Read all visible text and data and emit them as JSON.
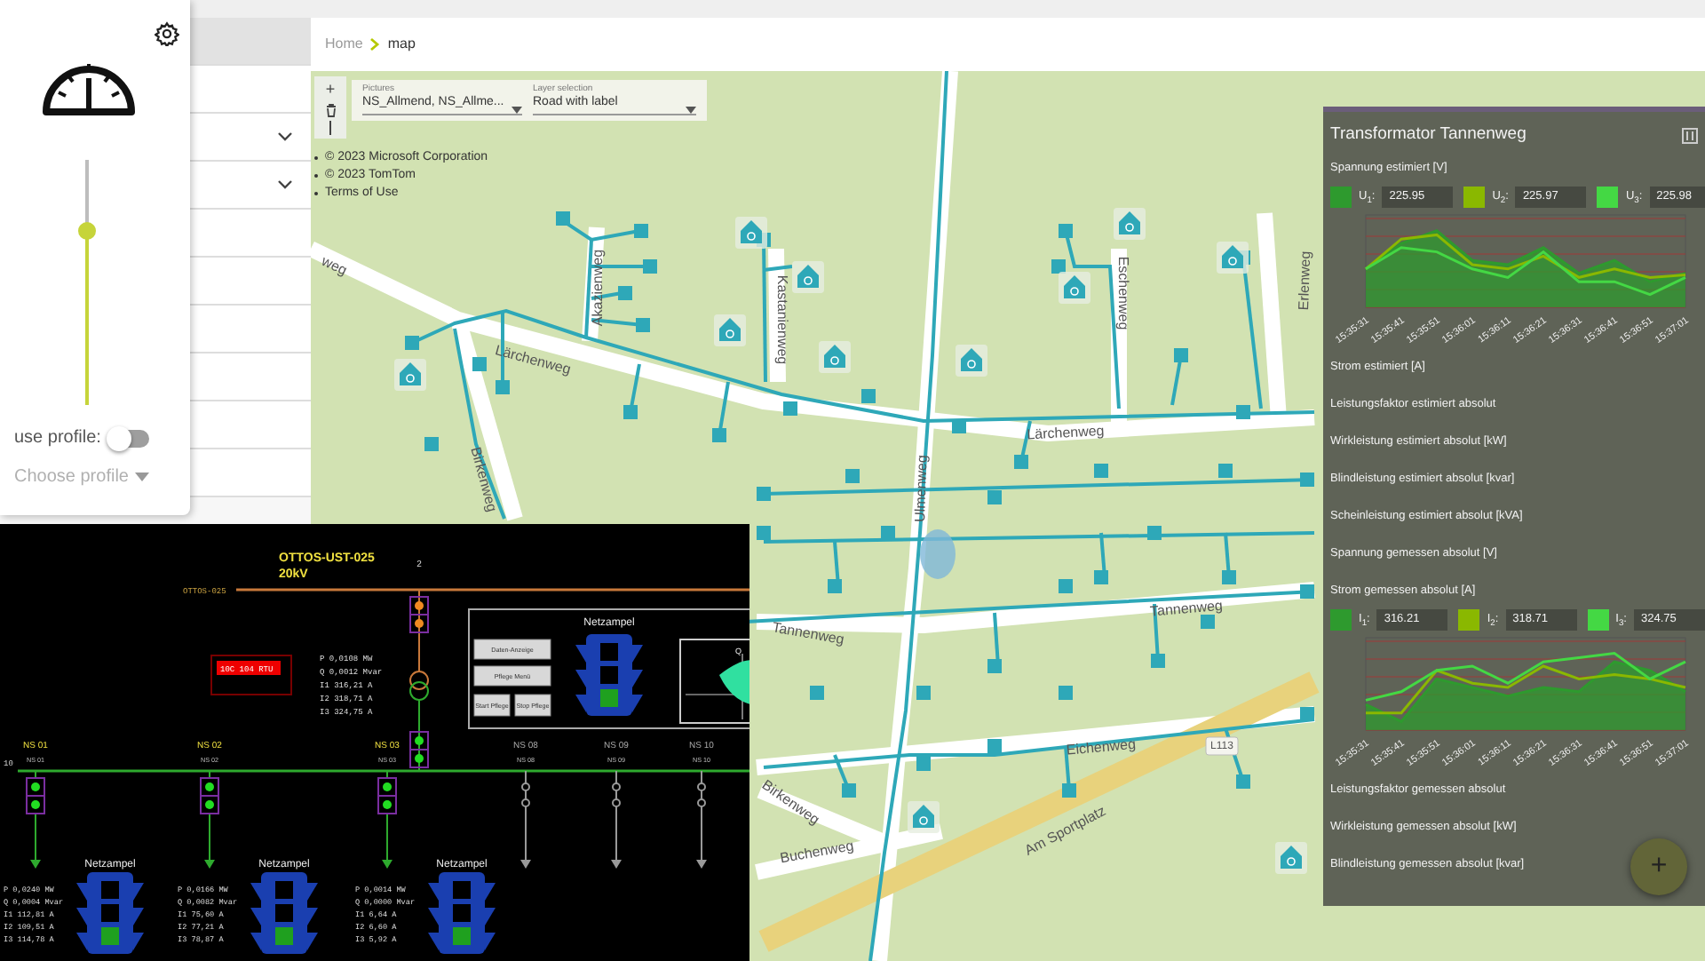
{
  "header": {
    "breadcrumb": [
      {
        "label": "Home",
        "selected": false
      },
      {
        "label": "map",
        "selected": true
      }
    ]
  },
  "settings_card": {
    "slider": {
      "level": 0.71
    },
    "use_profile": {
      "label": "use profile:",
      "on": false
    },
    "profile_select": {
      "placeholder": "Choose profile"
    }
  },
  "sidebar": {
    "rows": [
      {
        "kind": "header"
      },
      {
        "kind": "plain"
      },
      {
        "kind": "expandable"
      },
      {
        "kind": "expandable"
      },
      {
        "kind": "plain"
      },
      {
        "kind": "plain"
      },
      {
        "kind": "plain"
      },
      {
        "kind": "plain"
      },
      {
        "kind": "plain"
      },
      {
        "kind": "plain"
      }
    ]
  },
  "map": {
    "toolbar": {
      "zoom_in": "+"
    },
    "pictures_select": {
      "label": "Pictures",
      "value": "NS_Allmend, NS_Allme..."
    },
    "layer_select": {
      "label": "Layer selection",
      "value": "Road with label"
    },
    "attribution": [
      "© 2023 Microsoft Corporation",
      "© 2023 TomTom",
      "Terms of Use"
    ],
    "street_labels": [
      "weg",
      "Lärchenweg",
      "Lärchenweg",
      "Ulmenweg",
      "Tannenweg",
      "Tannenweg",
      "Eichenweg",
      "Birkenweg",
      "Buchenweg",
      "Am Sportplatz",
      "Akazienweg",
      "Kastanienweg",
      "Eschenweg",
      "Erlenweg",
      "Birkenweg",
      "L113"
    ]
  },
  "scada": {
    "station": "OTTOS-UST-025",
    "voltage": "20kV",
    "feeder_number": "2",
    "busbar_label": "OTTOS-025",
    "busbar_number": "10",
    "alarm": "10C 104 RTU",
    "transformer_readings": [
      "P  0,0108 MW",
      "Q  0,0012 Mvar",
      "I1  316,21 A",
      "I2  318,71 A",
      "I3  324,75 A"
    ],
    "control_box": {
      "title": "Netzampel",
      "lamps": [
        {
          "on": false
        },
        {
          "on": false
        },
        {
          "on": true
        }
      ],
      "buttons": [
        "Daten-Anzeige",
        "Pflege Menü",
        "Start Pflege",
        "Stop Pflege"
      ],
      "pq_axis": "Q"
    },
    "outlets": [
      {
        "name": "NS 01",
        "sub_label": "NS 01",
        "kind": "active",
        "netzampel": {
          "title": "Netzampel",
          "lamps": [
            {
              "on": false
            },
            {
              "on": false
            },
            {
              "on": true
            }
          ]
        },
        "readings": [
          "P  0,0240 MW",
          "Q  0,0004 Mvar",
          "I1  112,81 A",
          "I2  109,51 A",
          "I3  114,78 A"
        ]
      },
      {
        "name": "NS 02",
        "sub_label": "NS 02",
        "kind": "active",
        "netzampel": {
          "title": "Netzampel",
          "lamps": [
            {
              "on": false
            },
            {
              "on": false
            },
            {
              "on": true
            }
          ]
        },
        "readings": [
          "P  0,0166 MW",
          "Q  0,0082 Mvar",
          "I1  75,60 A",
          "I2  77,21 A",
          "I3  78,87 A"
        ]
      },
      {
        "name": "NS 03",
        "sub_label": "NS 03",
        "kind": "active",
        "netzampel": {
          "title": "Netzampel",
          "lamps": [
            {
              "on": false
            },
            {
              "on": false
            },
            {
              "on": true
            }
          ]
        },
        "readings": [
          "P  0,0014 MW",
          "Q  0,0000 Mvar",
          "I1  6,64 A",
          "I2  6,60 A",
          "I3  5,92 A"
        ]
      },
      {
        "name": "NS 08",
        "sub_label": "NS 08",
        "kind": "spare"
      },
      {
        "name": "NS 09",
        "sub_label": "NS 09",
        "kind": "spare"
      },
      {
        "name": "NS 10",
        "sub_label": "NS 10",
        "kind": "spare"
      }
    ]
  },
  "transformer_panel": {
    "title": "Transformator Tannenweg",
    "sections": [
      {
        "kind": "chart",
        "label": "Spannung estimiert [V]",
        "legend": [
          {
            "symbol": "U$_{1}$:",
            "value": "225.95",
            "color": "#2e9a2e"
          },
          {
            "symbol": "U$_{2}$:",
            "value": "225.97",
            "color": "#8ab800"
          },
          {
            "symbol": "U$_{3}$:",
            "value": "225.98",
            "color": "#44d844"
          }
        ],
        "x_labels": [
          "15:35:31",
          "15:35:41",
          "15:35:51",
          "15:36:01",
          "15:36:11",
          "15:36:21",
          "15:36:31",
          "15:36:41",
          "15:36:51",
          "15:37:01"
        ]
      },
      {
        "kind": "plain",
        "label": "Strom estimiert [A]"
      },
      {
        "kind": "plain",
        "label": "Leistungsfaktor estimiert absolut"
      },
      {
        "kind": "plain",
        "label": "Wirkleistung estimiert absolut [kW]"
      },
      {
        "kind": "plain",
        "label": "Blindleistung estimiert absolut [kvar]"
      },
      {
        "kind": "plain",
        "label": "Scheinleistung estimiert absolut [kVA]"
      },
      {
        "kind": "plain",
        "label": "Spannung gemessen absolut [V]"
      },
      {
        "kind": "chart",
        "label": "Strom gemessen absolut [A]",
        "legend": [
          {
            "symbol": "I$_{1}$:",
            "value": "316.21",
            "color": "#2e9a2e"
          },
          {
            "symbol": "I$_{2}$:",
            "value": "318.71",
            "color": "#8ab800"
          },
          {
            "symbol": "I$_{3}$:",
            "value": "324.75",
            "color": "#44d844"
          }
        ],
        "x_labels": [
          "15:35:31",
          "15:35:41",
          "15:35:51",
          "15:36:01",
          "15:36:11",
          "15:36:21",
          "15:36:31",
          "15:36:41",
          "15:36:51",
          "15:37:01"
        ]
      },
      {
        "kind": "plain",
        "label": "Leistungsfaktor gemessen absolut"
      },
      {
        "kind": "plain",
        "label": "Wirkleistung gemessen absolut [kW]"
      },
      {
        "kind": "plain",
        "label": "Blindleistung gemessen absolut [kvar]"
      }
    ],
    "fab": {
      "label": "+"
    }
  }
}
